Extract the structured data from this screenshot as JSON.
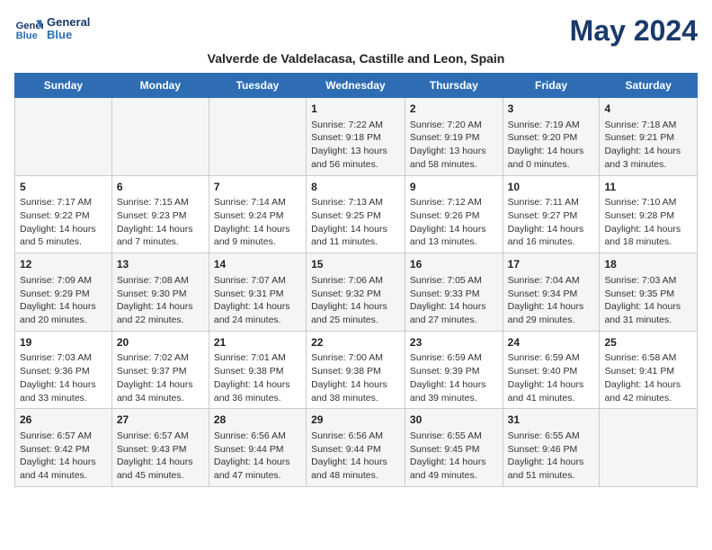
{
  "header": {
    "logo_line1": "General",
    "logo_line2": "Blue",
    "month_year": "May 2024",
    "subtitle": "Valverde de Valdelacasa, Castille and Leon, Spain"
  },
  "days_of_week": [
    "Sunday",
    "Monday",
    "Tuesday",
    "Wednesday",
    "Thursday",
    "Friday",
    "Saturday"
  ],
  "weeks": [
    [
      {
        "day": "",
        "content": ""
      },
      {
        "day": "",
        "content": ""
      },
      {
        "day": "",
        "content": ""
      },
      {
        "day": "1",
        "content": "Sunrise: 7:22 AM\nSunset: 9:18 PM\nDaylight: 13 hours and 56 minutes."
      },
      {
        "day": "2",
        "content": "Sunrise: 7:20 AM\nSunset: 9:19 PM\nDaylight: 13 hours and 58 minutes."
      },
      {
        "day": "3",
        "content": "Sunrise: 7:19 AM\nSunset: 9:20 PM\nDaylight: 14 hours and 0 minutes."
      },
      {
        "day": "4",
        "content": "Sunrise: 7:18 AM\nSunset: 9:21 PM\nDaylight: 14 hours and 3 minutes."
      }
    ],
    [
      {
        "day": "5",
        "content": "Sunrise: 7:17 AM\nSunset: 9:22 PM\nDaylight: 14 hours and 5 minutes."
      },
      {
        "day": "6",
        "content": "Sunrise: 7:15 AM\nSunset: 9:23 PM\nDaylight: 14 hours and 7 minutes."
      },
      {
        "day": "7",
        "content": "Sunrise: 7:14 AM\nSunset: 9:24 PM\nDaylight: 14 hours and 9 minutes."
      },
      {
        "day": "8",
        "content": "Sunrise: 7:13 AM\nSunset: 9:25 PM\nDaylight: 14 hours and 11 minutes."
      },
      {
        "day": "9",
        "content": "Sunrise: 7:12 AM\nSunset: 9:26 PM\nDaylight: 14 hours and 13 minutes."
      },
      {
        "day": "10",
        "content": "Sunrise: 7:11 AM\nSunset: 9:27 PM\nDaylight: 14 hours and 16 minutes."
      },
      {
        "day": "11",
        "content": "Sunrise: 7:10 AM\nSunset: 9:28 PM\nDaylight: 14 hours and 18 minutes."
      }
    ],
    [
      {
        "day": "12",
        "content": "Sunrise: 7:09 AM\nSunset: 9:29 PM\nDaylight: 14 hours and 20 minutes."
      },
      {
        "day": "13",
        "content": "Sunrise: 7:08 AM\nSunset: 9:30 PM\nDaylight: 14 hours and 22 minutes."
      },
      {
        "day": "14",
        "content": "Sunrise: 7:07 AM\nSunset: 9:31 PM\nDaylight: 14 hours and 24 minutes."
      },
      {
        "day": "15",
        "content": "Sunrise: 7:06 AM\nSunset: 9:32 PM\nDaylight: 14 hours and 25 minutes."
      },
      {
        "day": "16",
        "content": "Sunrise: 7:05 AM\nSunset: 9:33 PM\nDaylight: 14 hours and 27 minutes."
      },
      {
        "day": "17",
        "content": "Sunrise: 7:04 AM\nSunset: 9:34 PM\nDaylight: 14 hours and 29 minutes."
      },
      {
        "day": "18",
        "content": "Sunrise: 7:03 AM\nSunset: 9:35 PM\nDaylight: 14 hours and 31 minutes."
      }
    ],
    [
      {
        "day": "19",
        "content": "Sunrise: 7:03 AM\nSunset: 9:36 PM\nDaylight: 14 hours and 33 minutes."
      },
      {
        "day": "20",
        "content": "Sunrise: 7:02 AM\nSunset: 9:37 PM\nDaylight: 14 hours and 34 minutes."
      },
      {
        "day": "21",
        "content": "Sunrise: 7:01 AM\nSunset: 9:38 PM\nDaylight: 14 hours and 36 minutes."
      },
      {
        "day": "22",
        "content": "Sunrise: 7:00 AM\nSunset: 9:38 PM\nDaylight: 14 hours and 38 minutes."
      },
      {
        "day": "23",
        "content": "Sunrise: 6:59 AM\nSunset: 9:39 PM\nDaylight: 14 hours and 39 minutes."
      },
      {
        "day": "24",
        "content": "Sunrise: 6:59 AM\nSunset: 9:40 PM\nDaylight: 14 hours and 41 minutes."
      },
      {
        "day": "25",
        "content": "Sunrise: 6:58 AM\nSunset: 9:41 PM\nDaylight: 14 hours and 42 minutes."
      }
    ],
    [
      {
        "day": "26",
        "content": "Sunrise: 6:57 AM\nSunset: 9:42 PM\nDaylight: 14 hours and 44 minutes."
      },
      {
        "day": "27",
        "content": "Sunrise: 6:57 AM\nSunset: 9:43 PM\nDaylight: 14 hours and 45 minutes."
      },
      {
        "day": "28",
        "content": "Sunrise: 6:56 AM\nSunset: 9:44 PM\nDaylight: 14 hours and 47 minutes."
      },
      {
        "day": "29",
        "content": "Sunrise: 6:56 AM\nSunset: 9:44 PM\nDaylight: 14 hours and 48 minutes."
      },
      {
        "day": "30",
        "content": "Sunrise: 6:55 AM\nSunset: 9:45 PM\nDaylight: 14 hours and 49 minutes."
      },
      {
        "day": "31",
        "content": "Sunrise: 6:55 AM\nSunset: 9:46 PM\nDaylight: 14 hours and 51 minutes."
      },
      {
        "day": "",
        "content": ""
      }
    ]
  ]
}
